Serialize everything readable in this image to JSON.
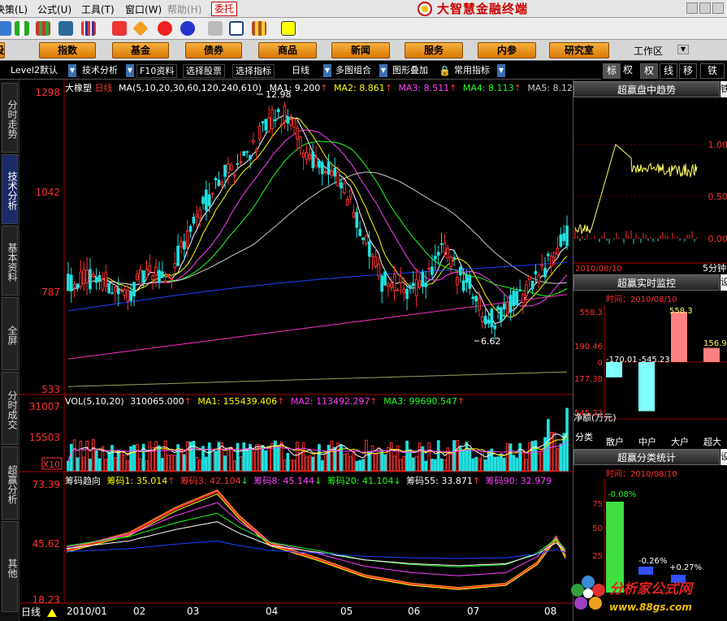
{
  "menu": {
    "items": [
      "决策(L)",
      "公式(U)",
      "工具(T)",
      "窗口(W)",
      "帮助(H)"
    ],
    "trade": "委托",
    "brand": "大智慧金融终端"
  },
  "toolbar": {
    "icons": [
      "back-arrow-icon",
      "flag-icon",
      "grid-icon",
      "binoculars-icon",
      "bars-icon",
      "bookmark-icon",
      "diamond-icon",
      "f-circle-icon",
      "f2-circle-icon",
      "save-icon",
      "window-icon",
      "books-icon",
      "help-pointer-icon"
    ]
  },
  "navbar": {
    "buttons": [
      "股",
      "指数",
      "基金",
      "债券",
      "商品",
      "新闻",
      "服务",
      "内参",
      "研究室"
    ],
    "workspace": "工作区"
  },
  "subtool": {
    "level2": "Level2默认",
    "tech": "技术分析",
    "f10": "F10资料",
    "pick_stock": "选择股票",
    "pick_indicator": "选择指标",
    "daily": "日线",
    "multi": "多图组合",
    "overlay": "图形叠加",
    "common": "常用指标"
  },
  "rtabs": [
    "标",
    "权",
    "权",
    "线",
    "移",
    "铁"
  ],
  "left_tabs": [
    "分时走势",
    "技术分析",
    "基本资料",
    "全屏",
    "分时成交",
    "超赢分析",
    "其他"
  ],
  "main_chart": {
    "name": "大橡塑",
    "period": "日线",
    "ma_label": "MA(5,10,20,30,60,120,240,610)",
    "ma1": "MA1: 9.200",
    "ma2": "MA2: 8.861",
    "ma3": "MA3: 8.511",
    "ma4": "MA4: 8.113",
    "ma5": "MA5: 8.120",
    "y_ticks": [
      "1298",
      "1042",
      "787",
      "533"
    ],
    "high_label": "12.98",
    "low_label": "6.62"
  },
  "vol_chart": {
    "label": "VOL(5,10,20)",
    "vol": "310065.000",
    "ma1": "MA1: 155439.406",
    "ma2": "MA2: 113492.297",
    "ma3": "MA3: 99690.547",
    "y_ticks": [
      "31007",
      "15503",
      "X10"
    ]
  },
  "chip_chart": {
    "label": "筹码趋向",
    "c1": "筹码1: 35.014",
    "c3": "筹码3: 42.104",
    "c8": "筹码8: 45.144",
    "c20": "筹码20: 41.104",
    "c55": "筹码55: 33.871",
    "c90": "筹码90: 32.979",
    "y_ticks": [
      "73.39",
      "45.62",
      "18.23"
    ]
  },
  "x_axis": {
    "labels": [
      "2010/01",
      "02",
      "03",
      "04",
      "05",
      "06",
      "07",
      "08"
    ],
    "period_btn": "日线"
  },
  "right_panel": {
    "trend_title": "超赢盘中趋势",
    "trend_date": "2010/08/10",
    "trend_side": "5分钟",
    "trend_y": [
      "1.00",
      "0.50",
      "0.00"
    ],
    "monitor_title": "超赢实时监控",
    "monitor_time": "时间：2010/08/10",
    "monitor_y": [
      "558.3",
      "190.46",
      "0",
      "177.38",
      "545.23"
    ],
    "monitor_bar_values": [
      "-170.01",
      "-545.23",
      "558.3",
      "156.9"
    ],
    "monitor_cats": [
      "散户",
      "中户",
      "大户",
      "超大"
    ],
    "monitor_net": "净额(万元)",
    "monitor_cls": "分类",
    "classify_title": "超赢分类统计",
    "classify_time": "时间：2010/08/10",
    "classify_y": [
      "75",
      "50",
      "25"
    ],
    "classify_values": [
      "-0.08%",
      "-0.26%",
      "+0.27%"
    ],
    "side_label": "设"
  },
  "watermark": {
    "name": "分析家公式网",
    "url": "www.88gs.com"
  },
  "colors": {
    "up": "#ff3030",
    "down": "#20e0e0",
    "ma1": "#ffffff",
    "ma2": "#ffff00",
    "ma3": "#ff40ff",
    "ma4": "#20ff20",
    "ma5": "#c8c8c8",
    "ma6": "#2040ff",
    "ma7": "#ff30c0",
    "ma8": "#a0a060"
  }
}
